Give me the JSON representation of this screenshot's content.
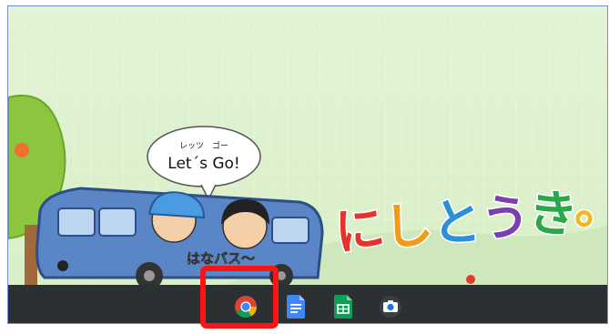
{
  "wallpaper": {
    "speech": {
      "small": "レッツ　ゴー",
      "main": "Let´s Go!"
    },
    "bus_label": "はなバス〜",
    "logo": [
      {
        "char": "に",
        "color": "#e8312a"
      },
      {
        "char": "し",
        "color": "#f39a1a"
      },
      {
        "char": "と",
        "color": "#2e8fd9"
      },
      {
        "char": "う",
        "color": "#7a3fb0"
      },
      {
        "char": "き",
        "color": "#2aa84a"
      },
      {
        "char": "。",
        "color": "#f0b820"
      }
    ]
  },
  "shelf": {
    "apps": [
      {
        "name": "Chrome",
        "icon": "chrome-icon"
      },
      {
        "name": "Google Docs",
        "icon": "docs-icon"
      },
      {
        "name": "Google Sheets",
        "icon": "sheets-icon"
      },
      {
        "name": "Camera",
        "icon": "camera-icon"
      }
    ]
  },
  "colors": {
    "shelf": "#2b3033",
    "highlight": "#ff1212",
    "bus": "#5a86c8"
  }
}
